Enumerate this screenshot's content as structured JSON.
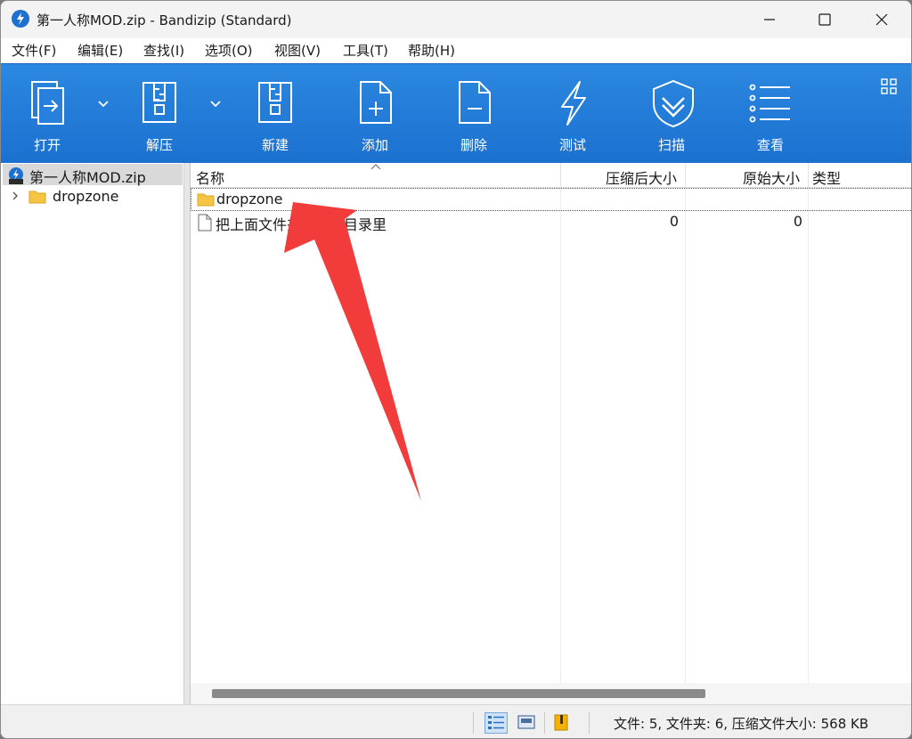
{
  "window": {
    "title": "第一人称MOD.zip - Bandizip (Standard)"
  },
  "menu": {
    "items": [
      {
        "label": "文件(F)"
      },
      {
        "label": "编辑(E)"
      },
      {
        "label": "查找(I)"
      },
      {
        "label": "选项(O)"
      },
      {
        "label": "视图(V)"
      },
      {
        "label": "工具(T)"
      },
      {
        "label": "帮助(H)"
      }
    ]
  },
  "toolbar": {
    "open_label": "打开",
    "extract_label": "解压",
    "new_label": "新建",
    "add_label": "添加",
    "delete_label": "删除",
    "test_label": "测试",
    "scan_label": "扫描",
    "view_label": "查看"
  },
  "tree": {
    "root": "第一人称MOD.zip",
    "children": [
      {
        "label": "dropzone"
      }
    ]
  },
  "list": {
    "columns": {
      "name": "名称",
      "compressed": "压缩后大小",
      "original": "原始大小",
      "type": "类型"
    },
    "rows": [
      {
        "name": "dropzone",
        "compressed": "",
        "original": "",
        "type": ""
      },
      {
        "name": "把上面文件夹放游戏目录里",
        "compressed": "0",
        "original": "0",
        "type": ""
      }
    ]
  },
  "status": {
    "text": "文件: 5, 文件夹: 6, 压缩文件大小: 568 KB"
  },
  "colors": {
    "toolbar": "#1f78d6",
    "accent_arrow": "#f23b3b"
  }
}
